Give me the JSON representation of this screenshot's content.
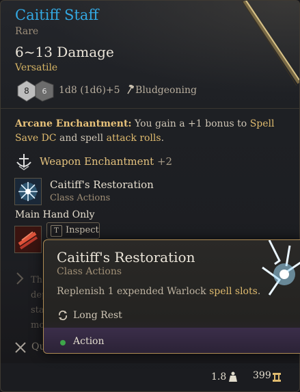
{
  "item": {
    "name": "Caitiff Staff",
    "rarity": "Rare",
    "damage": "6~13 Damage",
    "property": "Versatile",
    "damage_roll": "1d8 (1d6)+5",
    "damage_type": "Bludgeoning",
    "dice": [
      "8",
      "6"
    ]
  },
  "enchantment": {
    "name": "Arcane Enchantment:",
    "text_a": " You gain a +1 bonus to ",
    "highlight_1": "Spell Save DC",
    "text_b": " and spell ",
    "highlight_2": "attack rolls",
    "text_c": "."
  },
  "weapon_enchantment": {
    "label": "Weapon Enchantment",
    "bonus": "+2"
  },
  "granted_action": {
    "name": "Caitiff's Restoration",
    "category": "Class Actions"
  },
  "main_hand_only": "Main Hand Only",
  "inspect_button": {
    "key": "T",
    "label": "Inspect"
  },
  "background_lower": {
    "text_lines": [
      "Th",
      "dep",
      "sta",
      "mo"
    ],
    "action_text": "Qu"
  },
  "tooltip": {
    "title": "Caitiff's Restoration",
    "category": "Class Actions",
    "desc_a": "Replenish 1 expended Warlock ",
    "desc_highlight": "spell slots",
    "desc_b": ".",
    "recharge": "Long Rest",
    "cost": "Action"
  },
  "footer": {
    "weight": "1.8",
    "value": "399"
  },
  "colors": {
    "name_blue": "#33a9e3",
    "gold": "#e0bb6e",
    "border": "#b08d55",
    "action_dot": "#3ea64a"
  },
  "icons": [
    "d8-die-icon",
    "d6-die-icon",
    "hammer-icon",
    "weapon-enchantment-icon",
    "caitiff-restoration-icon",
    "main-hand-icon",
    "long-rest-icon",
    "weight-icon",
    "gold-icon"
  ]
}
